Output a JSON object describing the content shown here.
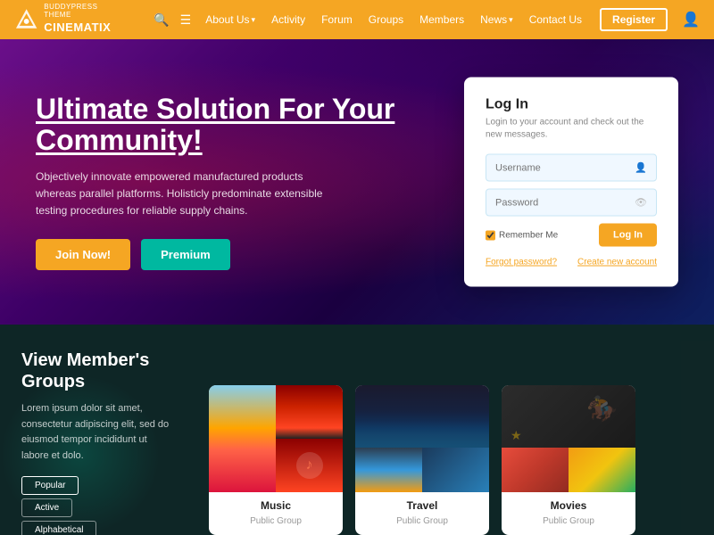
{
  "brand": {
    "sub_label": "BUDDYPRESS THEME",
    "name": "CINEMATIX"
  },
  "navbar": {
    "search_icon": "🔍",
    "menu_icon": "☰",
    "links": [
      {
        "label": "About Us",
        "dropdown": true
      },
      {
        "label": "Activity",
        "dropdown": false
      },
      {
        "label": "Forum",
        "dropdown": false
      },
      {
        "label": "Groups",
        "dropdown": false
      },
      {
        "label": "Members",
        "dropdown": false
      },
      {
        "label": "News",
        "dropdown": true
      },
      {
        "label": "Contact Us",
        "dropdown": false
      }
    ],
    "register_label": "Register",
    "user_icon": "👤"
  },
  "hero": {
    "title": "Ultimate Solution For Your Community!",
    "subtitle": "Objectively innovate empowered manufactured products whereas parallel platforms. Holisticly predominate extensible testing procedures for reliable supply chains.",
    "btn_join": "Join Now!",
    "btn_premium": "Premium"
  },
  "login": {
    "title": "Log In",
    "description": "Login to your account and check out the new messages.",
    "username_placeholder": "Username",
    "password_placeholder": "Password",
    "username_icon": "👤",
    "password_icon": "👁",
    "remember_label": "Remember Me",
    "login_btn": "Log In",
    "forgot_password": "Forgot password?",
    "create_account": "Create new account"
  },
  "members_section": {
    "title": "View Member's Groups",
    "description": "Lorem ipsum dolor sit amet, consectetur adipiscing elit, sed do eiusmod tempor incididunt ut labore et dolo.",
    "filters": [
      {
        "label": "Popular",
        "active": true
      },
      {
        "label": "Active",
        "active": false
      },
      {
        "label": "Alphabetical",
        "active": false
      }
    ]
  },
  "groups": [
    {
      "name": "Music",
      "type": "Public Group",
      "layout": "split"
    },
    {
      "name": "Travel",
      "type": "Public Group",
      "layout": "split"
    },
    {
      "name": "Movies",
      "type": "Public Group",
      "layout": "split"
    }
  ]
}
